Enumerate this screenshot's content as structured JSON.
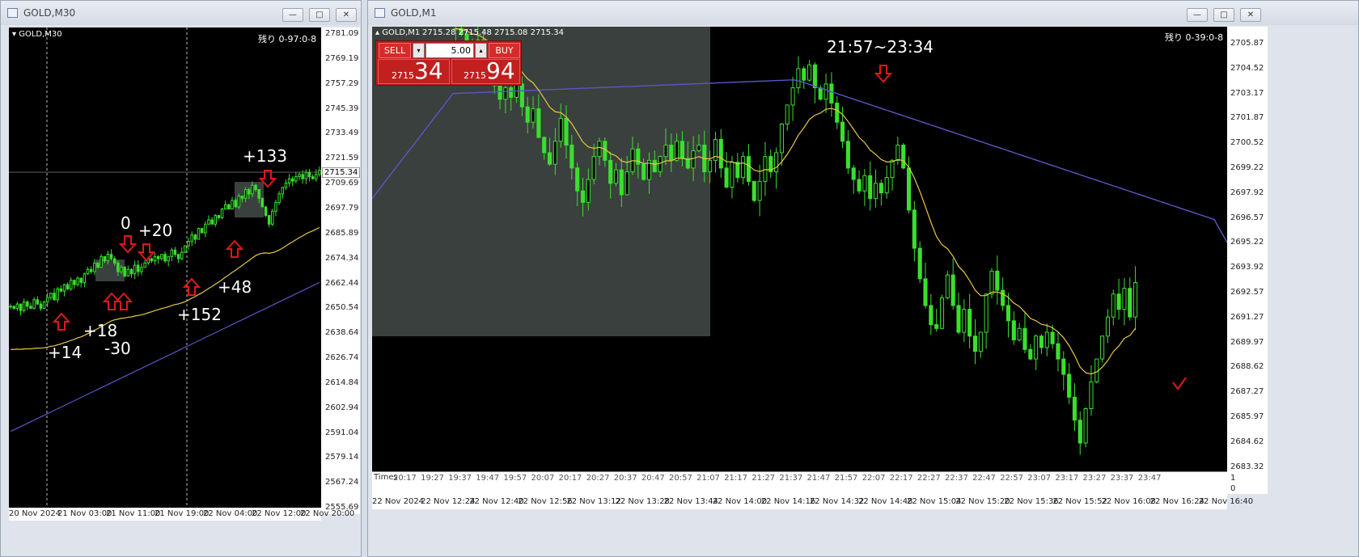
{
  "left_window": {
    "title": "GOLD,M30",
    "symbol_label": "GOLD,M30",
    "remaining": "残り 0-97:0-8",
    "current_price": "2715.34",
    "y_ticks": [
      "2781.09",
      "2769.19",
      "2757.29",
      "2745.39",
      "2733.49",
      "2721.59",
      "2709.69",
      "2697.79",
      "2685.89",
      "2674.34",
      "2662.44",
      "2650.54",
      "2638.64",
      "2626.74",
      "2614.84",
      "2602.94",
      "2591.04",
      "2579.14",
      "2567.24",
      "2555.69"
    ],
    "x_ticks": [
      "20 Nov 2024",
      "21 Nov 03:00",
      "21 Nov 11:00",
      "21 Nov 19:00",
      "22 Nov 04:00",
      "22 Nov 12:00",
      "22 Nov 20:00"
    ],
    "annotations": {
      "p133": "+133",
      "p0": "0",
      "p20": "+20",
      "p48": "+48",
      "p18": "+18",
      "p152": "+152",
      "p14": "+14",
      "m30": "-30"
    },
    "buttons": {
      "minimize": "—",
      "maximize": "□",
      "close": "✕"
    }
  },
  "right_window": {
    "title": "GOLD,M1",
    "symbol_label": "GOLD,M1",
    "ohlc": "2715.28 2715.48 2715.08 2715.34",
    "remaining": "残り 0-39:0-8",
    "time_range": "21:57~23:34",
    "y_ticks": [
      "2705.87",
      "2704.52",
      "2703.17",
      "2701.87",
      "2700.52",
      "2699.22",
      "2697.92",
      "2696.57",
      "2695.22",
      "2693.92",
      "2692.57",
      "2691.27",
      "2689.97",
      "2688.62",
      "2687.27",
      "2685.97",
      "2684.62",
      "2683.32"
    ],
    "sub_ticks": [
      "1",
      "0"
    ],
    "time_row": [
      "20:17",
      "19:27",
      "19:37",
      "19:47",
      "19:57",
      "20:07",
      "20:17",
      "20:27",
      "20:37",
      "20:47",
      "20:57",
      "21:07",
      "21:17",
      "21:27",
      "21:37",
      "21:47",
      "21:57",
      "22:07",
      "22:17",
      "22:27",
      "22:37",
      "22:47",
      "22:57",
      "23:07",
      "23:17",
      "23:27",
      "23:37",
      "23:47"
    ],
    "times_label": "Times",
    "x_ticks": [
      "22 Nov 2024",
      "22 Nov 12:24",
      "22 Nov 12:40",
      "22 Nov 12:56",
      "22 Nov 13:12",
      "22 Nov 13:28",
      "22 Nov 13:44",
      "22 Nov 14:00",
      "22 Nov 14:16",
      "22 Nov 14:32",
      "22 Nov 14:48",
      "22 Nov 15:04",
      "22 Nov 15:20",
      "22 Nov 15:36",
      "22 Nov 15:52",
      "22 Nov 16:08",
      "22 Nov 16:24",
      "22 Nov 16:40"
    ],
    "trade_panel": {
      "sell_label": "SELL",
      "buy_label": "BUY",
      "lot": "5.00",
      "sell_small": "2715",
      "sell_big": "34",
      "buy_small": "2715",
      "buy_big": "94"
    },
    "buttons": {
      "minimize": "—",
      "maximize": "□",
      "close": "✕"
    }
  },
  "colors": {
    "candle": "#3adf2e",
    "ma_fast": "#e6c845",
    "ma_slow": "#5a55c8",
    "arrow": "#e01818",
    "highlight": "#3a403d"
  },
  "chart_data": [
    {
      "type": "candlestick",
      "title": "GOLD,M30",
      "x_ticks": [
        "20 Nov 2024",
        "21 Nov 03:00",
        "21 Nov 11:00",
        "21 Nov 19:00",
        "22 Nov 04:00",
        "22 Nov 12:00",
        "22 Nov 20:00"
      ],
      "ylim": [
        2555.69,
        2781.09
      ],
      "close": [
        2652,
        2651,
        2653,
        2650,
        2654,
        2652,
        2651,
        2655,
        2653,
        2651,
        2654,
        2656,
        2658,
        2655,
        2660,
        2659,
        2662,
        2660,
        2664,
        2662,
        2665,
        2663,
        2667,
        2669,
        2668,
        2672,
        2670,
        2675,
        2673,
        2676,
        2674,
        2672,
        2668,
        2670,
        2666,
        2669,
        2667,
        2671,
        2668,
        2670,
        2672,
        2674,
        2673,
        2675,
        2674,
        2676,
        2673,
        2675,
        2678,
        2676,
        2674,
        2677,
        2680,
        2682,
        2685,
        2683,
        2688,
        2686,
        2690,
        2692,
        2690,
        2694,
        2693,
        2697,
        2699,
        2697,
        2701,
        2698,
        2703,
        2702,
        2706,
        2704,
        2708,
        2706,
        2702,
        2698,
        2694,
        2690,
        2696,
        2700,
        2704,
        2707,
        2709,
        2711,
        2710,
        2712,
        2713,
        2711,
        2714,
        2712,
        2711,
        2713,
        2715
      ]
    },
    {
      "type": "candlestick",
      "title": "GOLD,M1",
      "x_ticks": [
        "22 Nov 2024",
        "22 Nov 12:24",
        "22 Nov 12:40",
        "22 Nov 12:56",
        "22 Nov 13:12",
        "22 Nov 13:28",
        "22 Nov 13:44",
        "22 Nov 14:00",
        "22 Nov 14:16",
        "22 Nov 14:32",
        "22 Nov 14:48",
        "22 Nov 15:04",
        "22 Nov 15:20",
        "22 Nov 15:36",
        "22 Nov 15:52",
        "22 Nov 16:08",
        "22 Nov 16:24",
        "22 Nov 16:40"
      ],
      "ylim": [
        2683.32,
        2706.6
      ],
      "close": [
        2706.5,
        2706.2,
        2705.8,
        2705.2,
        2705.9,
        2705.0,
        2704.4,
        2703.5,
        2702.8,
        2703.4,
        2702.9,
        2703.6,
        2702.4,
        2701.6,
        2702.3,
        2700.8,
        2700.0,
        2699.4,
        2700.6,
        2701.8,
        2700.4,
        2699.2,
        2698.0,
        2697.4,
        2698.6,
        2699.8,
        2700.6,
        2699.6,
        2698.4,
        2699.1,
        2697.8,
        2699.0,
        2700.2,
        2699.4,
        2698.6,
        2699.6,
        2699.0,
        2699.8,
        2700.4,
        2699.6,
        2700.6,
        2699.7,
        2699.2,
        2700.1,
        2700.4,
        2699.0,
        2699.6,
        2700.7,
        2699.2,
        2698.2,
        2699.5,
        2698.7,
        2699.8,
        2698.5,
        2697.5,
        2698.5,
        2699.8,
        2699.0,
        2700.0,
        2701.5,
        2702.5,
        2703.4,
        2704.4,
        2703.8,
        2704.6,
        2703.4,
        2702.8,
        2703.6,
        2702.6,
        2701.6,
        2700.6,
        2699.2,
        2698.6,
        2698.0,
        2698.8,
        2697.6,
        2698.4,
        2697.9,
        2698.7,
        2699.6,
        2700.4,
        2699.2,
        2697.0,
        2695.0,
        2693.4,
        2692.0,
        2691.0,
        2690.8,
        2692.4,
        2693.6,
        2692.0,
        2690.6,
        2691.8,
        2690.4,
        2689.6,
        2690.6,
        2692.6,
        2693.8,
        2692.8,
        2692.0,
        2691.2,
        2690.2,
        2690.8,
        2689.7,
        2689.2,
        2690.4,
        2689.8,
        2690.6,
        2690.0,
        2689.2,
        2688.4,
        2687.2,
        2686.0,
        2684.8,
        2686.6,
        2688.0,
        2689.2,
        2690.4,
        2691.4,
        2692.6,
        2691.8,
        2692.9,
        2691.4,
        2693.2
      ]
    }
  ]
}
